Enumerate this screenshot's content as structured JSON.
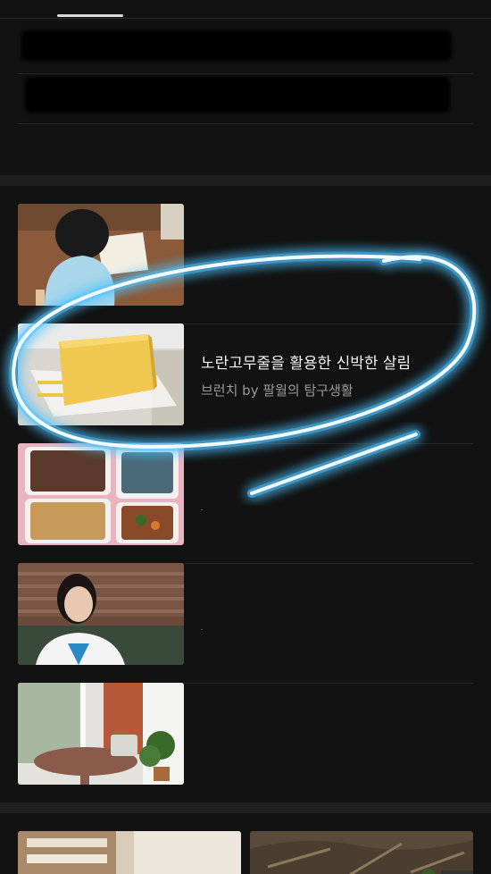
{
  "list": {
    "items": [
      {
        "title": "",
        "source": "",
        "thumb_icon": "child-reading-image"
      },
      {
        "title": "노란고무줄을 활용한 신박한 살림",
        "source": "브런치 by 팔월의 탐구생활",
        "thumb_icon": "sponge-on-tray-image"
      },
      {
        "title": "",
        "source": "",
        "thumb_icon": "lunchbox-food-image"
      },
      {
        "title": "",
        "source": "",
        "thumb_icon": "woman-portrait-image"
      },
      {
        "title": "",
        "source": "",
        "thumb_icon": "room-table-plant-image"
      }
    ]
  },
  "annotation": {
    "color": "#4fc3ff",
    "shape": "hand-drawn-ellipse"
  },
  "colors": {
    "background": "#121212",
    "title_text": "#f2f2f2",
    "source_text": "#9a9a9a"
  }
}
